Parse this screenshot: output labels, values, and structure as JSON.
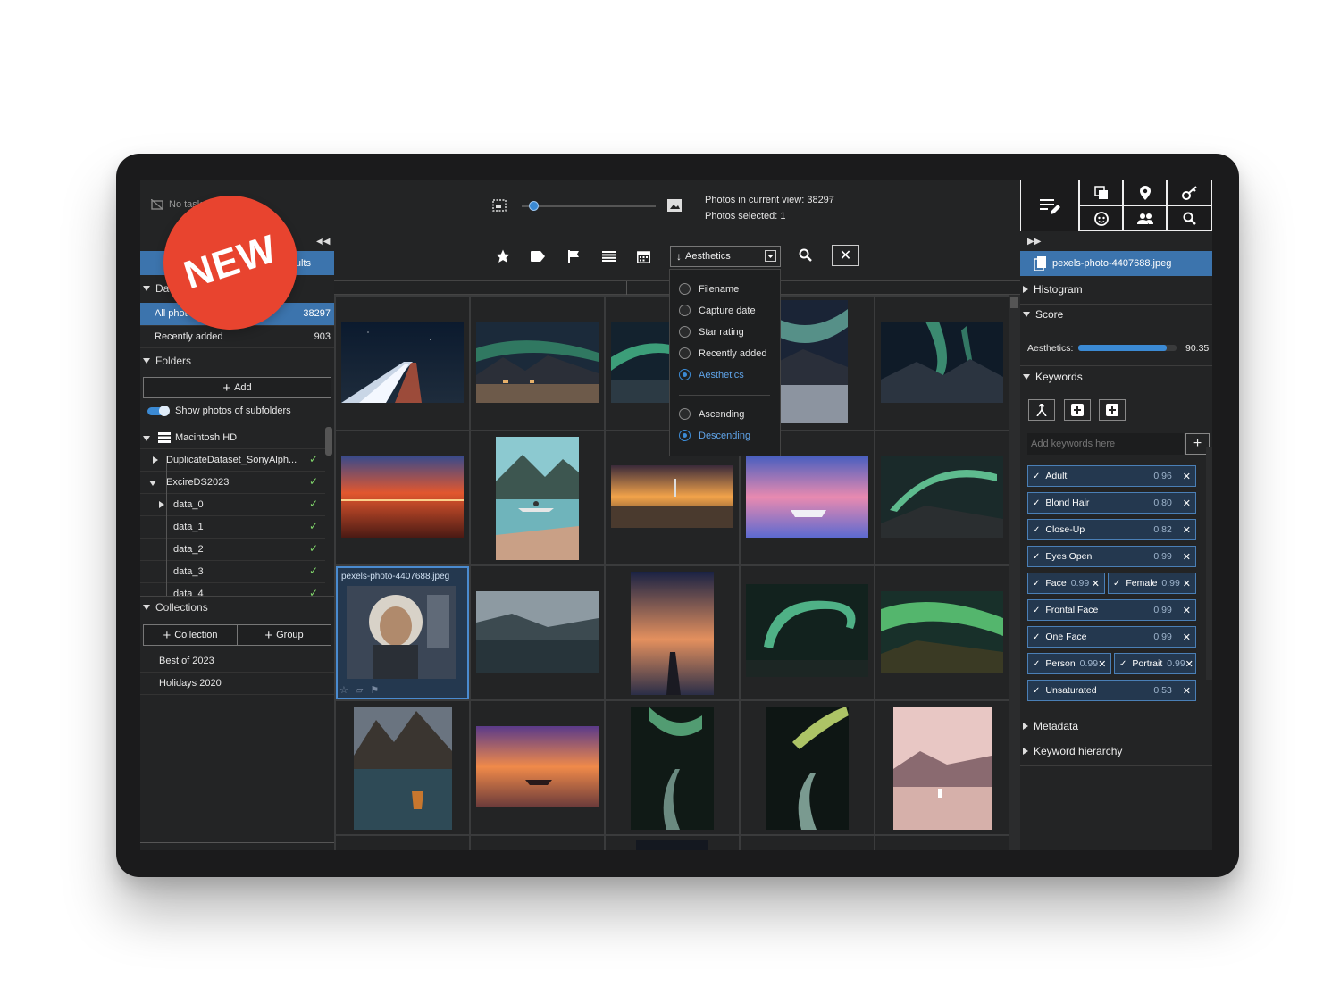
{
  "topbar": {
    "task_status": "No task",
    "photos_in_view": "Photos in current view: 38297",
    "photos_selected": "Photos selected: 1",
    "thumb_size_level": 0.05
  },
  "badge": {
    "label": "NEW"
  },
  "left": {
    "tab_label": "ults",
    "datasets_section": "Da",
    "datasets": [
      {
        "label": "All phot",
        "count": "38297"
      },
      {
        "label": "Recently added",
        "count": "903"
      }
    ],
    "folders_section": "Folders",
    "add_button": "Add",
    "show_subfolders": "Show photos of subfolders",
    "tree": [
      {
        "label": "Macintosh HD"
      },
      {
        "label": "DuplicateDataset_SonyAlph..."
      },
      {
        "label": "ExcireDS2023"
      },
      {
        "label": "data_0"
      },
      {
        "label": "data_1"
      },
      {
        "label": "data_2"
      },
      {
        "label": "data_3"
      },
      {
        "label": "data_4"
      }
    ],
    "collections_section": "Collections",
    "collection_button": "Collection",
    "group_button": "Group",
    "collections": [
      "Best of 2023",
      "Holidays 2020"
    ]
  },
  "sort": {
    "current": "Aesthetics",
    "options": [
      "Filename",
      "Capture date",
      "Star rating",
      "Recently added",
      "Aesthetics"
    ],
    "selected_option": "Aesthetics",
    "orders": [
      "Ascending",
      "Descending"
    ],
    "selected_order": "Descending"
  },
  "grid": {
    "selected_filename": "pexels-photo-4407688.jpeg"
  },
  "right": {
    "filename": "pexels-photo-4407688.jpeg",
    "histogram": "Histogram",
    "score": "Score",
    "aesthetics_label": "Aesthetics:",
    "aesthetics_value": "90.35",
    "aesthetics_level": 0.9035,
    "keywords": "Keywords",
    "keyword_placeholder": "Add keywords here",
    "tags": [
      {
        "label": "Adult",
        "score": "0.96"
      },
      {
        "label": "Blond Hair",
        "score": "0.80"
      },
      {
        "label": "Close-Up",
        "score": "0.82"
      },
      {
        "label": "Eyes Open",
        "score": "0.99"
      },
      {
        "label": "Face",
        "score": "0.99"
      },
      {
        "label": "Female",
        "score": "0.99"
      },
      {
        "label": "Frontal Face",
        "score": "0.99"
      },
      {
        "label": "One Face",
        "score": "0.99"
      },
      {
        "label": "Person",
        "score": "0.99"
      },
      {
        "label": "Portrait",
        "score": "0.99"
      },
      {
        "label": "Unsaturated",
        "score": "0.53"
      }
    ],
    "metadata": "Metadata",
    "keyword_hierarchy": "Keyword hierarchy"
  },
  "colors": {
    "accent": "#3b8ad4",
    "selection": "#3c74ad",
    "badge": "#e8442f",
    "check": "#7fd46a"
  }
}
